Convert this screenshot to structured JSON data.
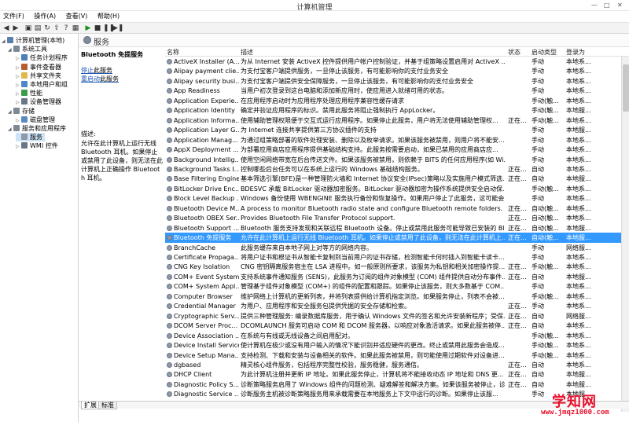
{
  "window": {
    "title": "计算机管理",
    "minimize": "—",
    "maximize": "□",
    "close": "✕"
  },
  "menu": [
    "文件(F)",
    "操作(A)",
    "查看(V)",
    "帮助(H)"
  ],
  "tree": {
    "items": [
      {
        "label": "计算机管理(本地)",
        "level": 0,
        "icon": "computer-icon",
        "color": "#5a7fa8",
        "expanded": true
      },
      {
        "label": "系统工具",
        "level": 1,
        "icon": "tools-icon",
        "color": "#7d8a96",
        "expanded": true
      },
      {
        "label": "任务计划程序",
        "level": 2,
        "icon": "clock-icon",
        "color": "#4a7fb8"
      },
      {
        "label": "事件查看器",
        "level": 2,
        "icon": "event-icon",
        "color": "#b85c2e"
      },
      {
        "label": "共享文件夹",
        "level": 2,
        "icon": "folder-icon",
        "color": "#e0b84a"
      },
      {
        "label": "本地用户和组",
        "level": 2,
        "icon": "users-icon",
        "color": "#4c88c8"
      },
      {
        "label": "性能",
        "level": 2,
        "icon": "performance-icon",
        "color": "#3f9b4c"
      },
      {
        "label": "设备管理器",
        "level": 2,
        "icon": "device-icon",
        "color": "#6a7788"
      },
      {
        "label": "存储",
        "level": 1,
        "icon": "storage-icon",
        "color": "#7d8a96",
        "expanded": true
      },
      {
        "label": "磁盘管理",
        "level": 2,
        "icon": "disk-icon",
        "color": "#5a8ac2"
      },
      {
        "label": "服务和应用程序",
        "level": 1,
        "icon": "services-apps-icon",
        "color": "#7d8a96",
        "expanded": true
      },
      {
        "label": "服务",
        "level": 2,
        "icon": "gear-icon",
        "color": "#8e98a8",
        "selected": true
      },
      {
        "label": "WMI 控件",
        "level": 2,
        "icon": "wmi-icon",
        "color": "#6a7788"
      }
    ]
  },
  "services_header": {
    "title": "服务"
  },
  "description_pane": {
    "service_name": "Bluetooth 免提服务",
    "stop_link": "停止",
    "stop_rest": "此服务",
    "restart_link": "重启动",
    "restart_rest": "此服务",
    "label": "描述:",
    "body": "允许在此计算机上运行无线 Bluetooth 耳机。如果停止或禁用了此设备，则无法在此计算机上正确操作 Bluetooth 耳机。"
  },
  "columns": {
    "name": "名称",
    "description": "描述",
    "status": "状态",
    "startup": "启动类型",
    "logon": "登录为"
  },
  "services": [
    {
      "name": "ActiveX Installer (A...",
      "description": "为从 Internet 安装 ActiveX 控件提供用户帐户控制验证，并基于组策略设置启用对 ActiveX ...",
      "status": "",
      "startup": "手动",
      "logon": "本地系..."
    },
    {
      "name": "Alipay payment clie...",
      "description": "为支付宝客户端提供服务，一旦停止该服务，有可能影响你的支付业务安全",
      "status": "",
      "startup": "手动",
      "logon": "本地系..."
    },
    {
      "name": "Alipay security busi...",
      "description": "为支付宝客户端提供安全保障服务，一旦停止该服务，有可能影响你的支付业务安全",
      "status": "",
      "startup": "手动",
      "logon": "本地系..."
    },
    {
      "name": "App Readiness",
      "description": "当用户初次登录到这台电脑和添加新应用时，使应用进入就绪可用的状态。",
      "status": "",
      "startup": "手动",
      "logon": "本地系..."
    },
    {
      "name": "Application Experie...",
      "description": "在应用程序启动时为应用程序处理应用程序兼容性缓存请求",
      "status": "",
      "startup": "手动(触...",
      "logon": "本地系..."
    },
    {
      "name": "Application Identity",
      "description": "确定并验证应用程序的标识。禁用此服务将阻止强制执行 AppLocker。",
      "status": "",
      "startup": "手动(触...",
      "logon": "本地服..."
    },
    {
      "name": "Application Informa...",
      "description": "使用辅助管理权限便于交互式运行应用程序。如果停止此服务，用户将无法使用辅助管理权...",
      "status": "正在...",
      "startup": "手动(触...",
      "logon": "本地系..."
    },
    {
      "name": "Application Layer G...",
      "description": "为 Internet 连接共享提供第三方协议插件的支持",
      "status": "",
      "startup": "手动",
      "logon": "本地服..."
    },
    {
      "name": "Application Manag...",
      "description": "为通过组策略部署的软件处理安装、删除以及枚举请求。如果该服务被禁用，则用户将不能安...",
      "status": "",
      "startup": "手动",
      "logon": "本地系..."
    },
    {
      "name": "AppX Deployment ...",
      "description": "为部署应用商店应用程序提供基础结构支持。此服务按需要启动，如果已禁用的应用商店应...",
      "status": "",
      "startup": "手动",
      "logon": "本地系..."
    },
    {
      "name": "Background Intellig...",
      "description": "使用空闲网络带宽在后台传送文件。如果该服务被禁用，则依赖于 BITS 的任何应用程序(如 Wi...",
      "status": "",
      "startup": "手动",
      "logon": "本地系..."
    },
    {
      "name": "Background Tasks I...",
      "description": "控制哪些后台任务可以在系统上运行的 Windows 基础结构服务。",
      "status": "正在...",
      "startup": "自动",
      "logon": "本地系..."
    },
    {
      "name": "Base Filtering Engine",
      "description": "基本筛选引擎(BFE)是一种管理防火墙和 Internet 协议安全(IPsec)策略以及实施用户模式筛选...",
      "status": "正在...",
      "startup": "自动",
      "logon": "本地服..."
    },
    {
      "name": "BitLocker Drive Enc...",
      "description": "BDESVC 承载 BitLocker 驱动器加密服务。BitLocker 驱动器加密为操作系统提供安全启动保...",
      "status": "",
      "startup": "手动(触...",
      "logon": "本地系..."
    },
    {
      "name": "Block Level Backup ...",
      "description": "Windows 备份使用 WBENGINE 服务执行备份和恢复操作。如果用户停止了此服务，这可能会...",
      "status": "",
      "startup": "手动",
      "logon": "本地系..."
    },
    {
      "name": "Bluetooth Device M...",
      "description": "A process to monitor Bluetooth radio state and configure Bluetooth remote folders.",
      "status": "正在...",
      "startup": "自动(触...",
      "logon": "本地系..."
    },
    {
      "name": "Bluetooth OBEX Ser...",
      "description": "Provides Bluetooth File Transfer Protocol support.",
      "status": "正在...",
      "startup": "自动(触...",
      "logon": "本地系..."
    },
    {
      "name": "Bluetooth Support ...",
      "description": "Bluetooth 服务支持发现和关联远程 Bluetooth 设备。停止或禁用此服务可能导致已安装的 Bl...",
      "status": "正在...",
      "startup": "自动(触...",
      "logon": "本地服..."
    },
    {
      "name": "Bluetooth 免提服务",
      "description": "允许在此计算机上运行无线 Bluetooth 耳机。如果停止或禁用了此设备，则无法在此计算机上...",
      "status": "正在...",
      "startup": "自动(触...",
      "logon": "本地服...",
      "selected": true
    },
    {
      "name": "BranchCache",
      "description": "此服务缓存来自本地子网上对等方的网络内容。",
      "status": "",
      "startup": "手动",
      "logon": "网络服..."
    },
    {
      "name": "Certificate Propaga...",
      "description": "将用户证书和根证书从智能卡复制到当前用户的证书存储，检测智能卡何时插入到智能卡读卡...",
      "status": "",
      "startup": "手动",
      "logon": "本地系..."
    },
    {
      "name": "CNG Key Isolation",
      "description": "CNG 密钥隔离服务宿主在 LSA 进程中。如一般原则所要求，该服务为私钥和相关加密操作提...",
      "status": "正在...",
      "startup": "手动(触...",
      "logon": "本地系..."
    },
    {
      "name": "COM+ Event System",
      "description": "支持系统事件通知服务 (SENS)，此服务为订阅的组件对象模型 (COM) 组件提供自动分布事件...",
      "status": "正在...",
      "startup": "自动",
      "logon": "本地服..."
    },
    {
      "name": "COM+ System Appl...",
      "description": "管理基于组件对象模型 (COM+) 的组件的配置和跟踪。如果停止该服务，则大多数基于 COM...",
      "status": "",
      "startup": "手动",
      "logon": "本地系..."
    },
    {
      "name": "Computer Browser",
      "description": "维护网络上计算机的更新列表，并将列表提供给计算机指定浏览。如果服务停止，列表不会被...",
      "status": "",
      "startup": "手动(触...",
      "logon": "本地系..."
    },
    {
      "name": "Credential Manager",
      "description": "为用户、应用程序和安全服务包提供凭据的安全存储和检索。",
      "status": "正在...",
      "startup": "手动",
      "logon": "本地系..."
    },
    {
      "name": "Cryptographic Serv...",
      "description": "提供三种管理服务: 编录数据库服务，用于确认 Windows 文件的签名和允许安装新程序；受保...",
      "status": "正在...",
      "startup": "自动",
      "logon": "网络服..."
    },
    {
      "name": "DCOM Server Proc...",
      "description": "DCOMLAUNCH 服务可启动 COM 和 DCOM 服务器，以响应对象激活请求。如果此服务被停...",
      "status": "正在...",
      "startup": "自动",
      "logon": "本地系..."
    },
    {
      "name": "Device Association ...",
      "description": "在系统与有线或无线设备之间启用配对。",
      "status": "",
      "startup": "手动(触...",
      "logon": "本地系..."
    },
    {
      "name": "Device Install Service",
      "description": "使计算机在极少或没有用户输入的情况下能识别并适应硬件的更改。终止或禁用此服务会造成...",
      "status": "",
      "startup": "手动(触...",
      "logon": "本地系..."
    },
    {
      "name": "Device Setup Mana...",
      "description": "支持检测、下载和安装与设备相关的软件。如果此服务被禁用，则可能使用过期软件对设备进...",
      "status": "",
      "startup": "手动(触...",
      "logon": "本地系..."
    },
    {
      "name": "dgbased",
      "description": "精灵核心组件服务，包括程序完整性校验，服务稳健，服务通信。",
      "status": "正在...",
      "startup": "自动",
      "logon": "本地系..."
    },
    {
      "name": "DHCP Client",
      "description": "为此计算机注册并更新 IP 地址。如果此服务停止，计算机将不能接收动态 IP 地址和 DNS 更...",
      "status": "正在...",
      "startup": "自动",
      "logon": "本地服..."
    },
    {
      "name": "Diagnostic Policy S...",
      "description": "诊断策略服务启用了 Windows 组件的问题检测、疑难解答和解决方案。如果该服务被停止，诊...",
      "status": "正在...",
      "startup": "自动",
      "logon": "本地服..."
    },
    {
      "name": "Diagnostic Service ...",
      "description": "诊断服务主机被诊断策略服务用来承载需要在本地服务上下文中运行的诊断。如果停止该服...",
      "status": "",
      "startup": "手动",
      "logon": "本地服..."
    }
  ],
  "bottom_tabs": [
    "扩展",
    "标准"
  ],
  "watermark": {
    "logo": "学知网",
    "url": "www.jmqz1000.com"
  }
}
